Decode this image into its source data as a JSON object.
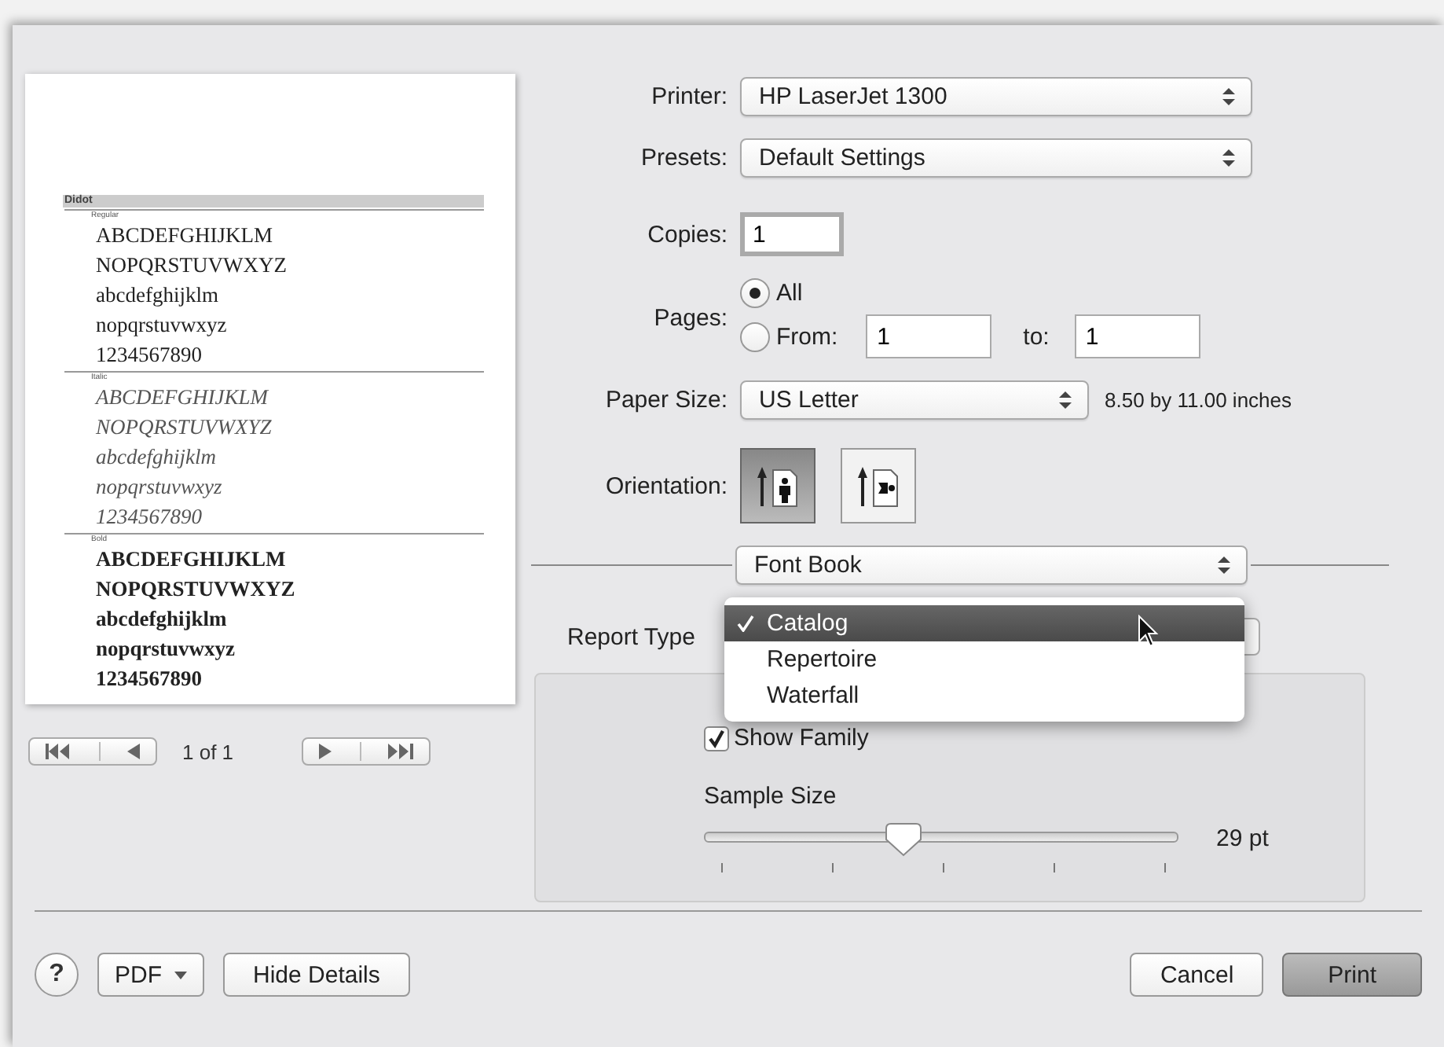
{
  "preview": {
    "family": "Didot",
    "styles": [
      {
        "name": "Regular",
        "kind": "regular",
        "lines": [
          "ABCDEFGHIJKLM",
          "NOPQRSTUVWXYZ",
          "abcdefghijklm",
          "nopqrstuvwxyz",
          "1234567890"
        ]
      },
      {
        "name": "Italic",
        "kind": "italic",
        "lines": [
          "ABCDEFGHIJKLM",
          "NOPQRSTUVWXYZ",
          "abcdefghijklm",
          "nopqrstuvwxyz",
          "1234567890"
        ]
      },
      {
        "name": "Bold",
        "kind": "bold",
        "lines": [
          "ABCDEFGHIJKLM",
          "NOPQRSTUVWXYZ",
          "abcdefghijklm",
          "nopqrstuvwxyz",
          "1234567890"
        ]
      }
    ],
    "page_indicator": "1 of 1"
  },
  "printer": {
    "label": "Printer:",
    "value": "HP LaserJet 1300"
  },
  "presets": {
    "label": "Presets:",
    "value": "Default Settings"
  },
  "copies": {
    "label": "Copies:",
    "value": "1"
  },
  "pages": {
    "label": "Pages:",
    "options": [
      {
        "label": "All",
        "selected": true
      },
      {
        "label": "From:",
        "selected": false
      }
    ],
    "from": "1",
    "to_label": "to:",
    "to": "1"
  },
  "paper_size": {
    "label": "Paper Size:",
    "value": "US Letter",
    "dimensions": "8.50 by 11.00 inches"
  },
  "orientation": {
    "label": "Orientation:",
    "options": [
      {
        "kind": "portrait",
        "selected": true
      },
      {
        "kind": "landscape",
        "selected": false
      }
    ]
  },
  "section": {
    "value": "Font Book"
  },
  "report_type": {
    "label": "Report Type",
    "menu": [
      {
        "label": "Catalog",
        "selected": true
      },
      {
        "label": "Repertoire",
        "selected": false
      },
      {
        "label": "Waterfall",
        "selected": false
      }
    ]
  },
  "show_family": {
    "label": "Show Family",
    "checked": true
  },
  "sample_size": {
    "label": "Sample Size",
    "level": 0.42,
    "reading": "29 pt"
  },
  "footer": {
    "help": "?",
    "pdf": "PDF",
    "details": "Hide Details",
    "cancel": "Cancel",
    "print": "Print"
  }
}
